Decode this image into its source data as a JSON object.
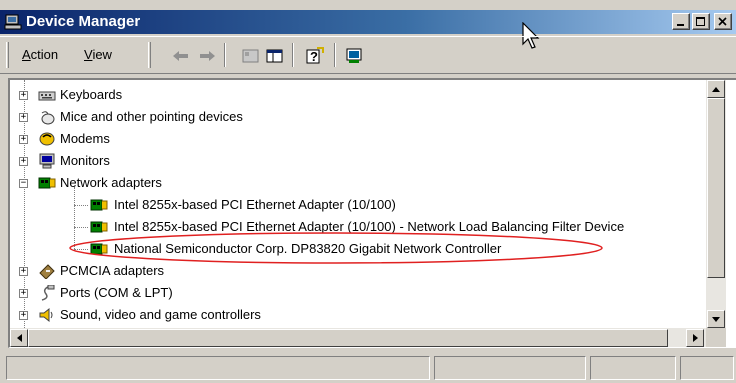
{
  "window": {
    "title": "Device Manager",
    "title_gradient_start": "#0a246a",
    "title_gradient_end": "#a6caf0"
  },
  "title_buttons": {
    "minimize_icon": "minimize-icon",
    "maximize_icon": "maximize-icon",
    "close_icon": "close-icon"
  },
  "menu": {
    "action": "Action",
    "action_u": "A",
    "action_rest": "ction",
    "view": "View",
    "view_u": "V",
    "view_rest": "iew"
  },
  "toolbar": {
    "buttons": [
      "back-arrow-icon",
      "forward-arrow-icon",
      "properties-icon",
      "show-hide-tree-icon",
      "help-icon",
      "scan-hardware-icon"
    ]
  },
  "tree": {
    "items": [
      {
        "label": "Keyboards",
        "icon": "keyboard-icon",
        "expander": "+"
      },
      {
        "label": "Mice and other pointing devices",
        "icon": "mouse-icon",
        "expander": "+"
      },
      {
        "label": "Modems",
        "icon": "modem-icon",
        "expander": "+"
      },
      {
        "label": "Monitors",
        "icon": "monitor-icon",
        "expander": "+"
      },
      {
        "label": "Network adapters",
        "icon": "network-adapter-icon",
        "expander": "−"
      },
      {
        "label": "Intel 8255x-based PCI Ethernet Adapter (10/100)",
        "icon": "network-card-icon"
      },
      {
        "label": "Intel 8255x-based PCI Ethernet Adapter (10/100) - Network Load Balancing Filter Device",
        "icon": "network-card-icon"
      },
      {
        "label": "National Semiconductor Corp. DP83820 Gigabit Network Controller",
        "icon": "network-card-icon"
      },
      {
        "label": "PCMCIA adapters",
        "icon": "pcmcia-icon",
        "expander": "+"
      },
      {
        "label": "Ports (COM & LPT)",
        "icon": "port-icon",
        "expander": "+"
      },
      {
        "label": "Sound, video and game controllers",
        "icon": "sound-icon",
        "expander": "+"
      }
    ]
  },
  "highlight": {
    "color": "#e02020"
  }
}
